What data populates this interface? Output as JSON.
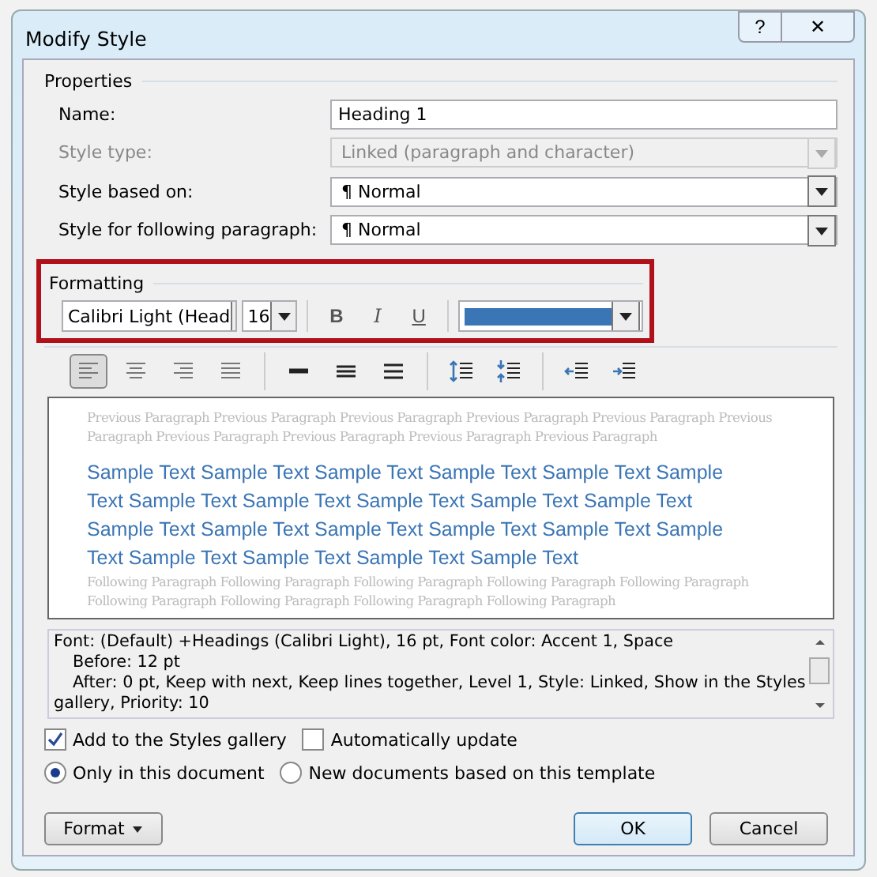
{
  "window": {
    "title": "Modify Style",
    "help": "?",
    "close": "✕"
  },
  "properties": {
    "heading": "Properties",
    "fields": [
      {
        "label": "Name:",
        "kind": "text",
        "value": "Heading 1",
        "disabled": false
      },
      {
        "label": "Style type:",
        "kind": "dropdown",
        "value": "Linked (paragraph and character)",
        "disabled": true
      },
      {
        "label": "Style based on:",
        "kind": "dropdown",
        "value": "¶  Normal",
        "disabled": false
      },
      {
        "label": "Style for following paragraph:",
        "kind": "dropdown",
        "value": "¶  Normal",
        "disabled": false
      }
    ]
  },
  "formatting": {
    "heading": "Formatting",
    "highlighted": true,
    "font": "Calibri Light (Head",
    "size": "16",
    "bold": "B",
    "italic": "I",
    "underline": "U",
    "color": "#3a75b5",
    "paragraph_buttons": [
      {
        "selected": true
      },
      {
        "selected": false
      },
      {
        "selected": false
      },
      {
        "selected": false
      },
      {
        "selected": false
      },
      {
        "selected": false
      },
      {
        "selected": false
      },
      {
        "selected": false
      },
      {
        "selected": false
      },
      {
        "selected": false
      },
      {
        "selected": false
      }
    ]
  },
  "preview": {
    "previous": [
      "Previous Paragraph Previous Paragraph Previous Paragraph Previous Paragraph Previous Paragraph Previous",
      "Paragraph Previous Paragraph Previous Paragraph Previous Paragraph Previous Paragraph"
    ],
    "sample": [
      "Sample Text Sample Text Sample Text Sample Text Sample Text Sample",
      "Text Sample Text Sample Text Sample Text Sample Text Sample Text",
      "Sample Text Sample Text Sample Text Sample Text Sample Text Sample",
      "Text Sample Text Sample Text Sample Text Sample Text"
    ],
    "following": [
      "Following Paragraph Following Paragraph Following Paragraph Following Paragraph Following Paragraph",
      "Following Paragraph Following Paragraph Following Paragraph Following Paragraph"
    ]
  },
  "description": [
    {
      "text": "Font: (Default) +Headings (Calibri Light), 16 pt, Font color: Accent 1, Space",
      "indented": false
    },
    {
      "text": "Before:  12 pt",
      "indented": true
    },
    {
      "text": "After:  0 pt, Keep with next, Keep lines together, Level 1, Style: Linked, Show in the Styles",
      "indented": true
    },
    {
      "text": "gallery, Priority: 10",
      "indented": false
    }
  ],
  "checkboxes": [
    {
      "label": "Add to the Styles gallery",
      "checked": true
    },
    {
      "label": "Automatically update",
      "checked": false
    }
  ],
  "radios": [
    {
      "label": "Only in this document",
      "selected": true
    },
    {
      "label": "New documents based on this template",
      "selected": false
    }
  ],
  "buttons": {
    "format": "Format",
    "ok": "OK",
    "cancel": "Cancel"
  }
}
